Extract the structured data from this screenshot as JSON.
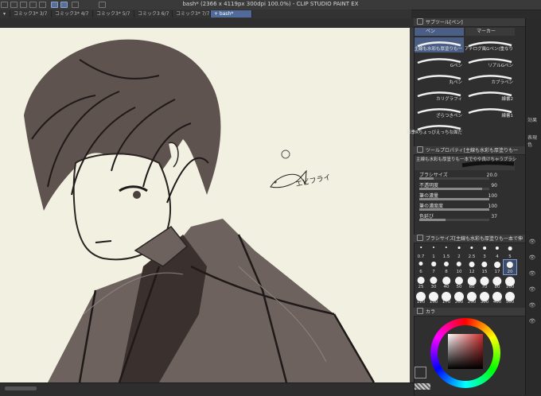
{
  "window": {
    "title": "bash* (2366 x 4119px 300dpi 100.0%)  - CLIP STUDIO PAINT EX"
  },
  "tabs": [
    {
      "label": "コミック3* 3/7"
    },
    {
      "label": "コミック3* 4/7"
    },
    {
      "label": "コミック3* 5/7"
    },
    {
      "label": "コミック3 6/7"
    },
    {
      "label": "コミック3* 7/7"
    },
    {
      "label": "+ bash*"
    }
  ],
  "canvas": {
    "annotation_text": "エビフライ",
    "background_color": "#f2f0e1"
  },
  "subtool_panel": {
    "header": "サブツール[ペン]",
    "tab_pen": "ペン",
    "tab_marker": "マーカー",
    "brushes": [
      {
        "label": "主線も水彩も厚塗りも一",
        "selected": true
      },
      {
        "label": "アナログ風Gペン(重なり",
        "selected": false
      },
      {
        "label": "Gペン",
        "selected": false
      },
      {
        "label": "リアルGペン",
        "selected": false
      },
      {
        "label": "丸ペン",
        "selected": false
      },
      {
        "label": "カブラペン",
        "selected": false
      },
      {
        "label": "カリグラフィ",
        "selected": false
      },
      {
        "label": "線書2",
        "selected": false
      },
      {
        "label": "ざらつきペン",
        "selected": false
      },
      {
        "label": "線書1",
        "selected": false
      },
      {
        "label": "彩季Rちょっびえっちな面だ",
        "selected": false
      }
    ]
  },
  "tool_property": {
    "header": "ツールプロパティ[主線も水彩も厚塗りも一",
    "preset_label": "主線も水彩も厚塗りも一本でやや良けちゃうブラシ",
    "rows": [
      {
        "label": "ブラシサイズ",
        "value": "20.0",
        "fill": 0.2
      },
      {
        "label": "不透明度",
        "value": "90",
        "fill": 0.9
      },
      {
        "label": "筆の濃量",
        "value": "100",
        "fill": 1.0
      },
      {
        "label": "筆の濃度度",
        "value": "100",
        "fill": 1.0
      },
      {
        "label": "色延び",
        "value": "37",
        "fill": 0.37
      }
    ]
  },
  "brush_size_panel": {
    "header": "ブラシサイズ[主線も水彩も厚塗りも一本で伸",
    "sizes": [
      "0.7",
      "1",
      "1.5",
      "2",
      "2.5",
      "3",
      "4",
      "5",
      "6",
      "7",
      "8",
      "10",
      "12",
      "15",
      "17",
      "20",
      "25",
      "30",
      "40",
      "50",
      "60",
      "70",
      "80",
      "100",
      "120",
      "150",
      "170",
      "200",
      "250",
      "300",
      "400",
      "500"
    ],
    "selected": "20"
  },
  "color_panel": {
    "header": "カラ",
    "main_color": "#000000",
    "selected_hue_color": "#cc2b2b"
  },
  "far_right": {
    "label_effect": "効果",
    "label_display_color": "表現色"
  }
}
